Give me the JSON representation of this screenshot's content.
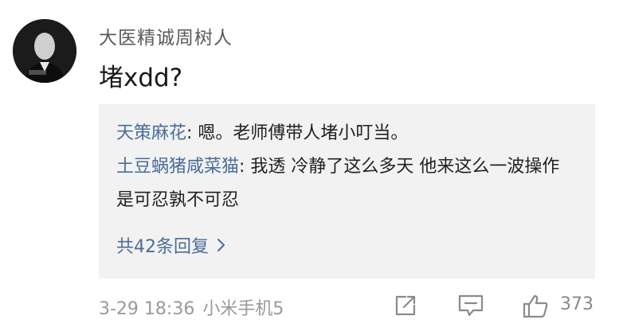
{
  "comment": {
    "username": "大医精诚周树人",
    "text": "堵xdd?",
    "avatar_icon": "avatar-photo",
    "replies": [
      {
        "author": "天策麻花",
        "separator": ": ",
        "text": "嗯。老师傅带人堵小叮当。"
      },
      {
        "author": "土豆蜗猪咸菜猫",
        "separator": ": ",
        "text": "我透 冷静了这么多天 他来这么一波操作 是可忍孰不可忍"
      }
    ],
    "more_replies_label": "共42条回复",
    "more_replies_icon": "chevron-right-icon",
    "timestamp": "3-29 18:36",
    "device": "小米手机5",
    "actions": {
      "share_icon": "share-icon",
      "reply_icon": "comment-icon",
      "like_icon": "thumbs-up-icon",
      "like_count": "373"
    },
    "colors": {
      "link_blue": "#4a6d97",
      "meta_gray": "#9a9a9a",
      "reply_bg": "#f2f2f2"
    }
  }
}
